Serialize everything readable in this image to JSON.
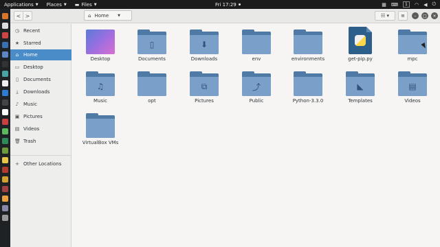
{
  "topbar": {
    "applications": "Applications",
    "places": "Places",
    "files": "Files",
    "clock": "Fri 17:29",
    "workspace": "1"
  },
  "header": {
    "location": "Home"
  },
  "sidebar": {
    "items": [
      {
        "label": "Recent",
        "icon": "clock-icon"
      },
      {
        "label": "Starred",
        "icon": "star-icon"
      },
      {
        "label": "Home",
        "icon": "home-icon"
      },
      {
        "label": "Desktop",
        "icon": "desktop-icon"
      },
      {
        "label": "Documents",
        "icon": "document-icon"
      },
      {
        "label": "Downloads",
        "icon": "download-icon"
      },
      {
        "label": "Music",
        "icon": "music-icon"
      },
      {
        "label": "Pictures",
        "icon": "picture-icon"
      },
      {
        "label": "Videos",
        "icon": "video-icon"
      },
      {
        "label": "Trash",
        "icon": "trash-icon"
      }
    ],
    "other": "Other Locations"
  },
  "files": [
    {
      "label": "Desktop",
      "kind": "desktop"
    },
    {
      "label": "Documents",
      "kind": "folder-documents"
    },
    {
      "label": "Downloads",
      "kind": "folder-downloads"
    },
    {
      "label": "env",
      "kind": "folder"
    },
    {
      "label": "environments",
      "kind": "folder"
    },
    {
      "label": "get-pip.py",
      "kind": "python-file"
    },
    {
      "label": "mpc",
      "kind": "folder"
    },
    {
      "label": "Music",
      "kind": "folder-music"
    },
    {
      "label": "opt",
      "kind": "folder"
    },
    {
      "label": "Pictures",
      "kind": "folder-pictures"
    },
    {
      "label": "Public",
      "kind": "folder-public"
    },
    {
      "label": "Python-3.3.0",
      "kind": "folder"
    },
    {
      "label": "Templates",
      "kind": "folder-templates"
    },
    {
      "label": "Videos",
      "kind": "folder-videos"
    },
    {
      "label": "VirtualBox VMs",
      "kind": "folder"
    }
  ],
  "colors": {
    "accent": "#4a8cc7",
    "folder_front": "#7a9fc8",
    "folder_back": "#4f7aa6"
  }
}
